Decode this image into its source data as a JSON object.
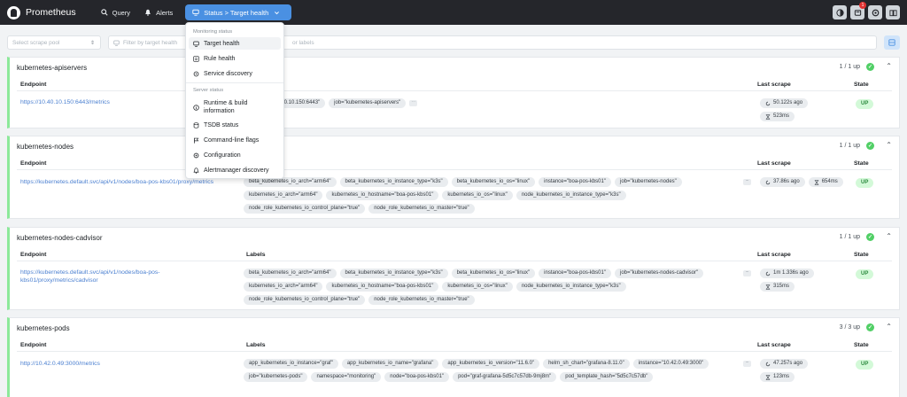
{
  "header": {
    "brand": "Prometheus",
    "nav": {
      "query": "Query",
      "alerts": "Alerts",
      "status": "Status > Target health"
    },
    "icons": [
      "theme-toggle-icon",
      "notifications-icon",
      "settings-icon",
      "docs-icon"
    ],
    "notification_count": "1"
  },
  "filters": {
    "scrape_pool_placeholder": "Select scrape pool",
    "target_placeholder_start": "Filter by target health",
    "target_placeholder_end": "or labels"
  },
  "table_headers": {
    "endpoint": "Endpoint",
    "labels": "Labels",
    "last_scrape": "Last scrape",
    "state": "State"
  },
  "pools": [
    {
      "name": "kubernetes-apiservers",
      "count": "1 / 1 up",
      "endpoint": "https://10.40.10.150:6443/metrics",
      "labels": [
        "instance=\"10.40.10.150:6443\"",
        "job=\"kubernetes-apiservers\""
      ],
      "scrape_ago": "50.122s ago",
      "duration": "523ms",
      "state": "UP"
    },
    {
      "name": "kubernetes-nodes",
      "count": "1 / 1 up",
      "endpoint": "https://kubernetes.default.svc/api/v1/nodes/boa-pos-kbs01/proxy/metrics",
      "labels": [
        "beta_kubernetes_io_arch=\"arm64\"",
        "beta_kubernetes_io_instance_type=\"k3s\"",
        "beta_kubernetes_io_os=\"linux\"",
        "instance=\"boa-pos-kbs01\"",
        "job=\"kubernetes-nodes\"",
        "kubernetes_io_arch=\"arm64\"",
        "kubernetes_io_hostname=\"boa-pos-kbs01\"",
        "kubernetes_io_os=\"linux\"",
        "node_kubernetes_io_instance_type=\"k3s\"",
        "node_role_kubernetes_io_control_plane=\"true\"",
        "node_role_kubernetes_io_master=\"true\""
      ],
      "scrape_ago": "37.86s ago",
      "duration": "654ms",
      "state": "UP"
    },
    {
      "name": "kubernetes-nodes-cadvisor",
      "count": "1 / 1 up",
      "endpoint": "https://kubernetes.default.svc/api/v1/nodes/boa-pos-kbs01/proxy/metrics/cadvisor",
      "labels": [
        "beta_kubernetes_io_arch=\"arm64\"",
        "beta_kubernetes_io_instance_type=\"k3s\"",
        "beta_kubernetes_io_os=\"linux\"",
        "instance=\"boa-pos-kbs01\"",
        "job=\"kubernetes-nodes-cadvisor\"",
        "kubernetes_io_arch=\"arm64\"",
        "kubernetes_io_hostname=\"boa-pos-kbs01\"",
        "kubernetes_io_os=\"linux\"",
        "node_kubernetes_io_instance_type=\"k3s\"",
        "node_role_kubernetes_io_control_plane=\"true\"",
        "node_role_kubernetes_io_master=\"true\""
      ],
      "scrape_ago": "1m 1.336s ago",
      "duration": "315ms",
      "state": "UP"
    },
    {
      "name": "kubernetes-pods",
      "count": "3 / 3 up",
      "endpoint": "http://10.42.0.49:3000/metrics",
      "labels": [
        "app_kubernetes_io_instance=\"graf\"",
        "app_kubernetes_io_name=\"grafana\"",
        "app_kubernetes_io_version=\"11.6.0\"",
        "helm_sh_chart=\"grafana-8.11.0\"",
        "instance=\"10.42.0.49:3000\"",
        "job=\"kubernetes-pods\"",
        "namespace=\"monitoring\"",
        "node=\"boa-pos-kbs01\"",
        "pod=\"graf-grafana-5d5c7c57db-9mj8m\"",
        "pod_template_hash=\"5d5c7c57db\""
      ],
      "scrape_ago": "47.257s ago",
      "duration": "123ms",
      "state": "UP"
    }
  ],
  "menu": {
    "section_monitoring": "Monitoring status",
    "monitoring_items": [
      "Target health",
      "Rule health",
      "Service discovery"
    ],
    "section_server": "Server status",
    "server_items": [
      "Runtime & build information",
      "TSDB status",
      "Command-line flags",
      "Configuration",
      "Alertmanager discovery"
    ]
  },
  "colors": {
    "header_bg": "#25262b",
    "accent": "#4a90e2",
    "up_border": "#8ce99a",
    "up_dot": "#51cf66",
    "link": "#4a7fd0"
  }
}
